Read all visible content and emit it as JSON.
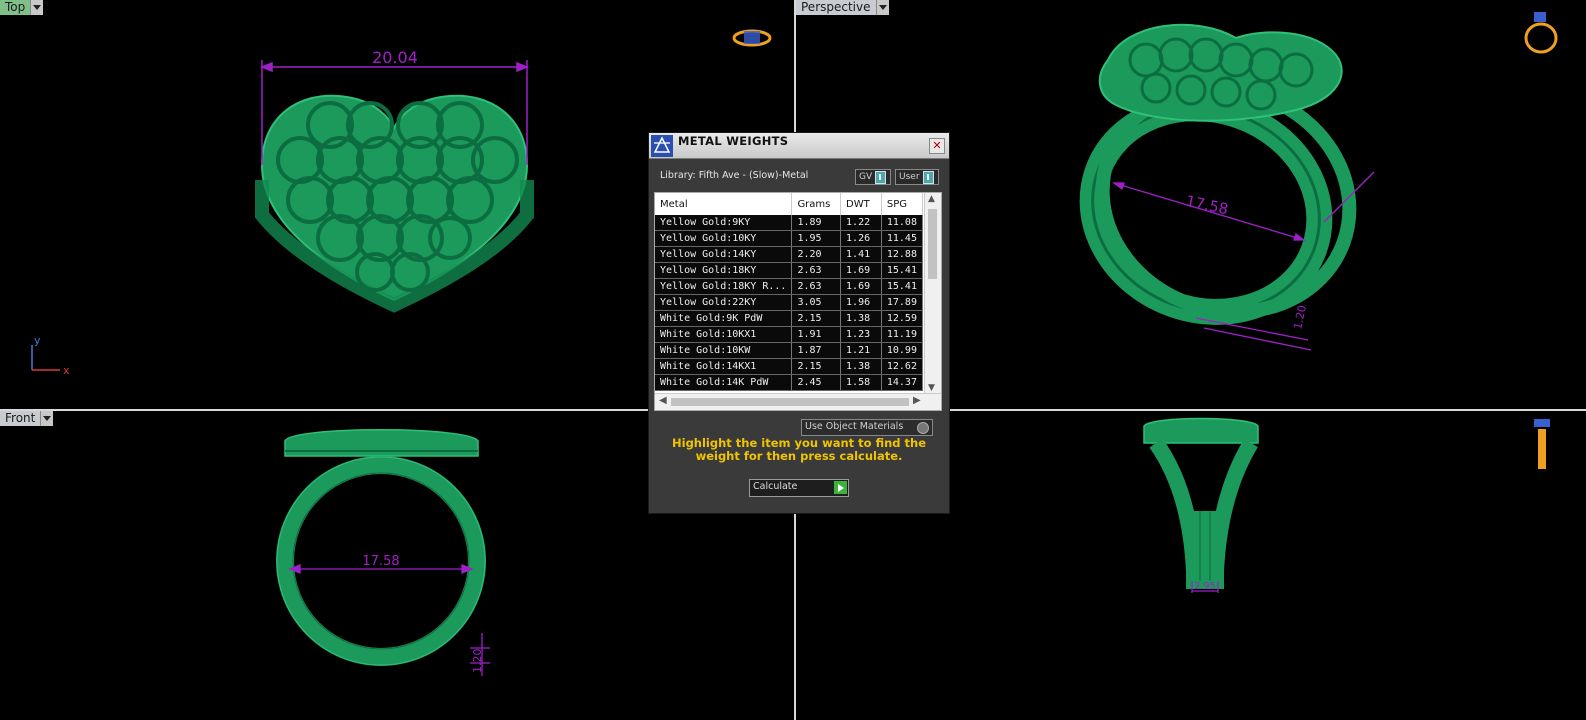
{
  "viewports": {
    "top": {
      "label": "Top",
      "dimension": "20.04",
      "axis_x": "x",
      "axis_y": "y"
    },
    "perspective": {
      "label": "Perspective",
      "dimension_main": "17.58",
      "dimension_side": "1.20"
    },
    "front": {
      "label": "Front",
      "dimension_main": "17.58",
      "dimension_side": "1.20"
    },
    "right": {
      "dimension_bottom": "2.95"
    }
  },
  "dialog": {
    "title": "METAL WEIGHTS",
    "library_label": "Library: Fifth Ave - (Slow)-Metal",
    "toggle_gv": "GV",
    "toggle_user": "User",
    "columns": [
      "Metal",
      "Grams",
      "DWT",
      "SPG"
    ],
    "rows": [
      [
        "Yellow Gold:9KY",
        "1.89",
        "1.22",
        "11.08"
      ],
      [
        "Yellow Gold:10KY",
        "1.95",
        "1.26",
        "11.45"
      ],
      [
        "Yellow Gold:14KY",
        "2.20",
        "1.41",
        "12.88"
      ],
      [
        "Yellow Gold:18KY",
        "2.63",
        "1.69",
        "15.41"
      ],
      [
        "Yellow Gold:18KY R...",
        "2.63",
        "1.69",
        "15.41"
      ],
      [
        "Yellow Gold:22KY",
        "3.05",
        "1.96",
        "17.89"
      ],
      [
        "White Gold:9K PdW",
        "2.15",
        "1.38",
        "12.59"
      ],
      [
        "White Gold:10KX1",
        "1.91",
        "1.23",
        "11.19"
      ],
      [
        "White Gold:10KW",
        "1.87",
        "1.21",
        "10.99"
      ],
      [
        "White Gold:14KX1",
        "2.15",
        "1.38",
        "12.62"
      ],
      [
        "White Gold:14K PdW",
        "2.45",
        "1.58",
        "14.37"
      ]
    ],
    "use_object_materials": "Use Object Materials",
    "hint": "Highlight the item you want to find the weight for then press calculate.",
    "calculate_label": "Calculate"
  },
  "colors": {
    "model": "#1fa565",
    "dimension": "#a020c8",
    "dialog_hint": "#f0c400",
    "label_active": "#7fbf8a"
  }
}
